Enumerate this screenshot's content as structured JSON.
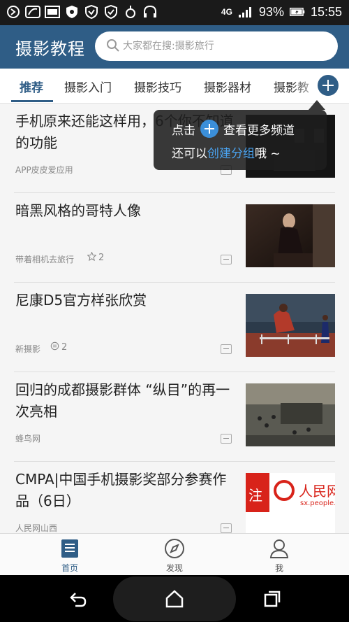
{
  "status_bar": {
    "battery": "93%",
    "time": "15:55",
    "network": "4G"
  },
  "header": {
    "app_title": "摄影教程",
    "search_placeholder": "大家都在搜:摄影旅行",
    "accent_color": "#2f5d86"
  },
  "tabs": [
    {
      "label": "推荐",
      "active": true
    },
    {
      "label": "摄影入门",
      "active": false
    },
    {
      "label": "摄影技巧",
      "active": false
    },
    {
      "label": "摄影器材",
      "active": false
    },
    {
      "label": "摄影教",
      "active": false
    }
  ],
  "tooltip": {
    "prefix": "点击",
    "suffix": "查看更多频道",
    "line2_prefix": "还可以",
    "line2_link": "创建分组",
    "line2_suffix": "哦 ~"
  },
  "articles": [
    {
      "title": "手机原来还能这样用，6个你不知道的功能",
      "source": "APP皮皮爱应用",
      "meta_icon": "",
      "meta_value": ""
    },
    {
      "title": "暗黑风格的哥特人像",
      "source": "带着相机去旅行",
      "meta_icon": "star-icon",
      "meta_value": "2"
    },
    {
      "title": "尼康D5官方样张欣赏",
      "source": "新摄影",
      "meta_icon": "comment-icon",
      "meta_value": "2"
    },
    {
      "title": "回归的成都摄影群体 “纵目”的再一次亮相",
      "source": "蜂鸟网",
      "meta_icon": "",
      "meta_value": ""
    },
    {
      "title": "CMPA|中国手机摄影奖部分参赛作品（6日）",
      "source": "人民网山西",
      "meta_icon": "",
      "meta_value": ""
    }
  ],
  "thumb5_text": {
    "left": "注",
    "brand": "人民网",
    "domain": "sx.people.c"
  },
  "bottom_nav": [
    {
      "label": "首页",
      "icon": "home-icon",
      "active": true
    },
    {
      "label": "发现",
      "icon": "compass-icon",
      "active": false
    },
    {
      "label": "我",
      "icon": "person-icon",
      "active": false
    }
  ]
}
